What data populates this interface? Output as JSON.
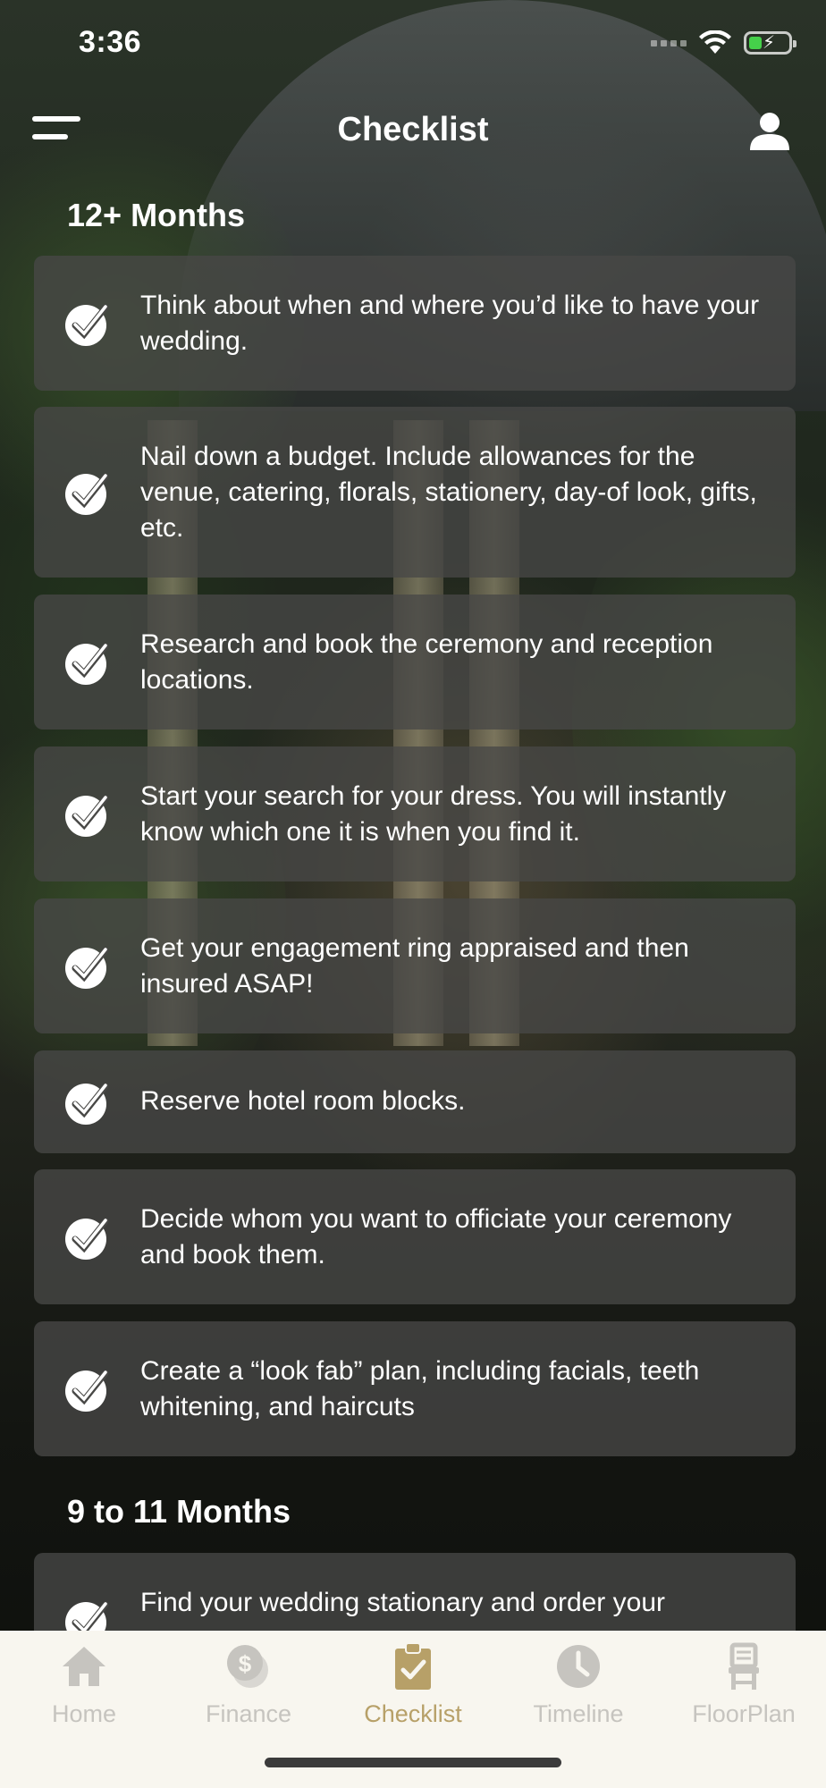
{
  "status_bar": {
    "time": "3:36"
  },
  "header": {
    "title": "Checklist"
  },
  "sections": [
    {
      "title": "12+ Months",
      "items": [
        "Think about when and where you’d like to have your wedding.",
        "Nail down a budget. Include allowances for the venue, catering, florals, stationery, day-of look, gifts, etc.",
        "Research and book the ceremony and reception locations.",
        "Start your search for your dress. You will instantly know which one it is when you find it.",
        "Get your engagement ring appraised and then insured ASAP!",
        "Reserve hotel room blocks.",
        "Decide whom you want to officiate your ceremony and book them.",
        "Create a “look fab” plan, including facials, teeth whitening, and haircuts"
      ]
    },
    {
      "title": "9 to 11 Months",
      "items": [
        "Find your wedding stationary and order your"
      ]
    }
  ],
  "tabs": [
    {
      "label": "Home",
      "icon": "home-icon",
      "active": false
    },
    {
      "label": "Finance",
      "icon": "finance-icon",
      "active": false
    },
    {
      "label": "Checklist",
      "icon": "clipboard-check-icon",
      "active": true
    },
    {
      "label": "Timeline",
      "icon": "clock-icon",
      "active": false
    },
    {
      "label": "FloorPlan",
      "icon": "chair-icon",
      "active": false
    }
  ],
  "colors": {
    "accent": "#b7a068",
    "inactive_tab": "#c6c4bf",
    "card_bg": "#484846",
    "tabbar_bg": "#f8f6ef"
  }
}
